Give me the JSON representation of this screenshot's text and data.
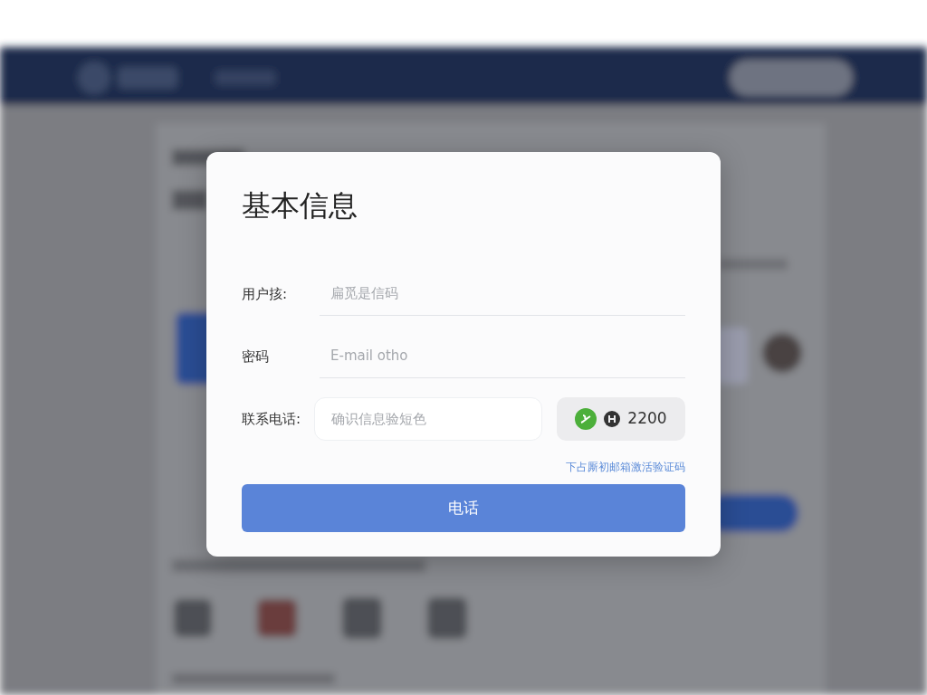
{
  "dialog": {
    "title": "基本信息",
    "fields": [
      {
        "kind": "underline",
        "label": "用户㧡:",
        "placeholder": "扁觅是信码"
      },
      {
        "kind": "underline",
        "label": "密码",
        "placeholder": "E-mail otho"
      },
      {
        "kind": "boxed",
        "label": "联系电话:",
        "placeholder": "确识信息验短色"
      }
    ],
    "code_button": {
      "text": "2200"
    },
    "link": "下占厮初邮箱激活验证码",
    "submit": "电话"
  }
}
